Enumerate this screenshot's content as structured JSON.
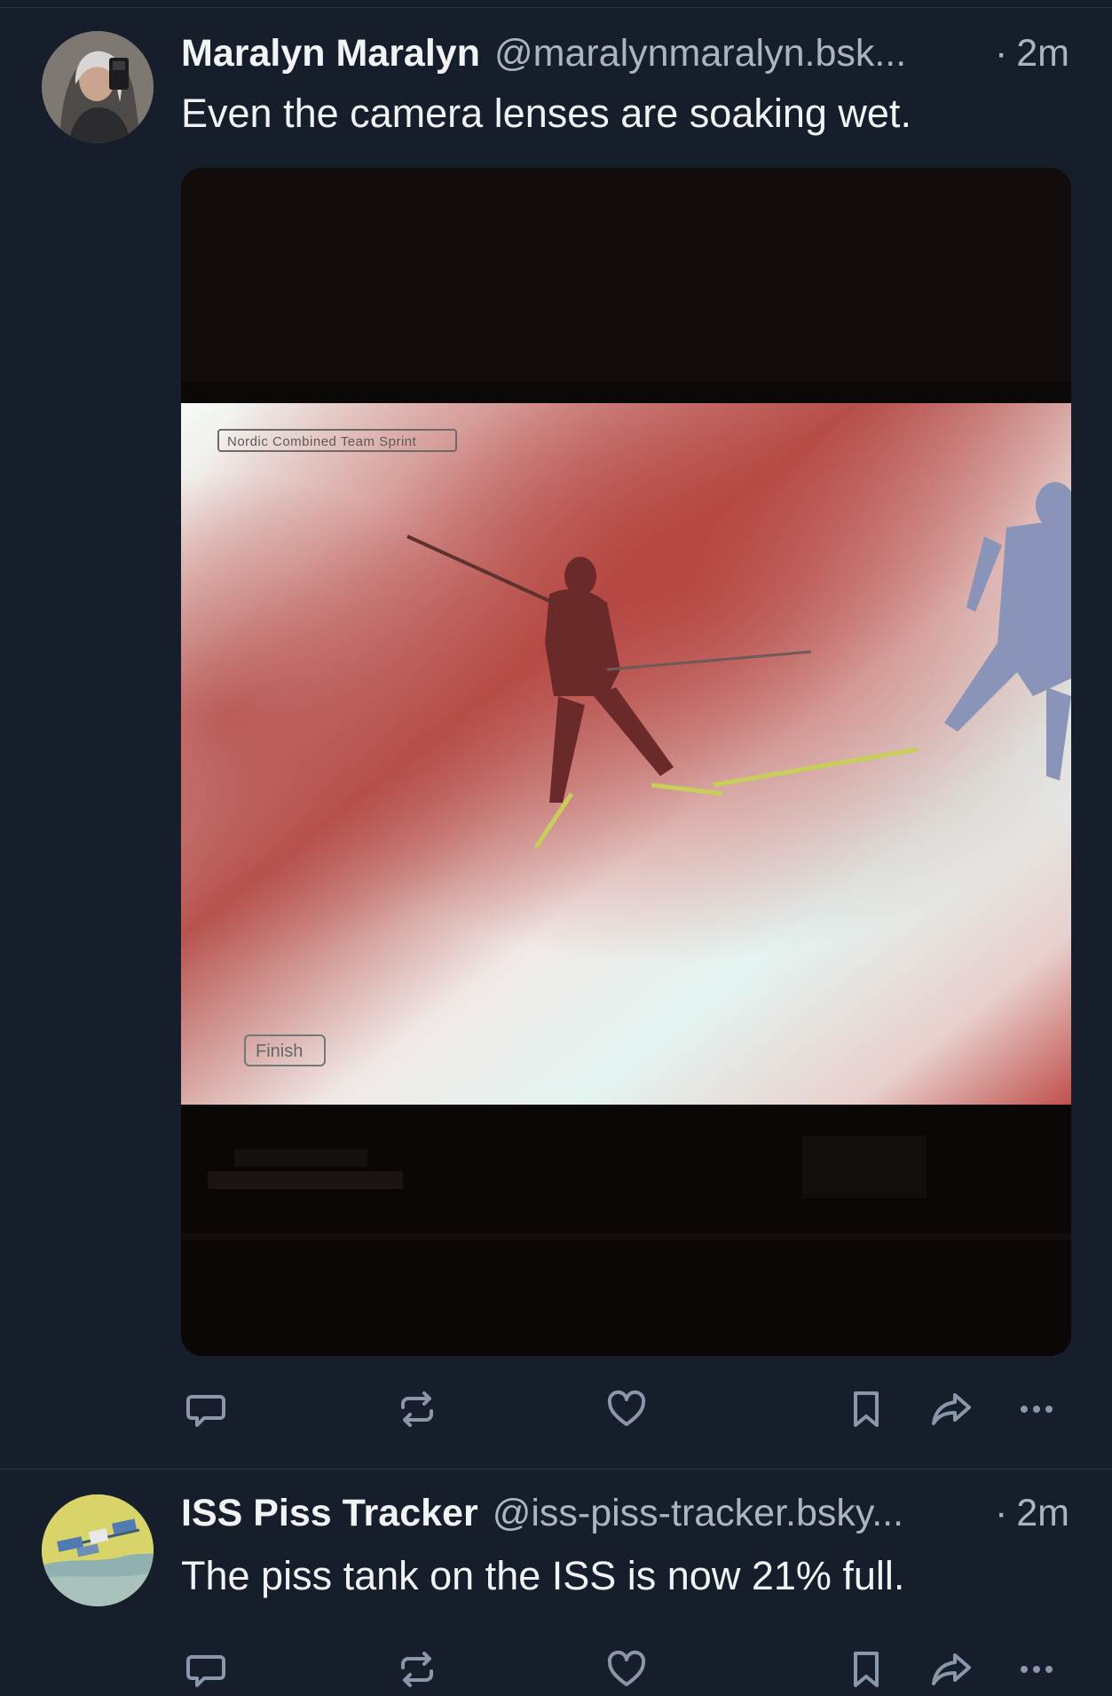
{
  "feed": {
    "posts": [
      {
        "author_name": "Maralyn Maralyn",
        "handle": "@maralynmaralyn.bsk...",
        "separator": "·",
        "time": "2m",
        "text": "Even the camera lenses are soaking wet.",
        "media": {
          "overlay_title": "Nordic Combined Team Sprint",
          "overlay_finish": "Finish"
        }
      },
      {
        "author_name": "ISS Piss Tracker",
        "handle": "@iss-piss-tracker.bsky...",
        "separator": "·",
        "time": "2m",
        "text": "The piss tank on the ISS is now 21% full."
      }
    ]
  },
  "icons": [
    "reply-icon",
    "repost-icon",
    "like-icon",
    "bookmark-icon",
    "share-icon",
    "more-icon"
  ],
  "colors": {
    "background": "#161e2b",
    "divider": "#2a3444",
    "text_primary": "#f1f3f5",
    "text_secondary": "#aab4c3",
    "icon": "#8a97ab"
  }
}
